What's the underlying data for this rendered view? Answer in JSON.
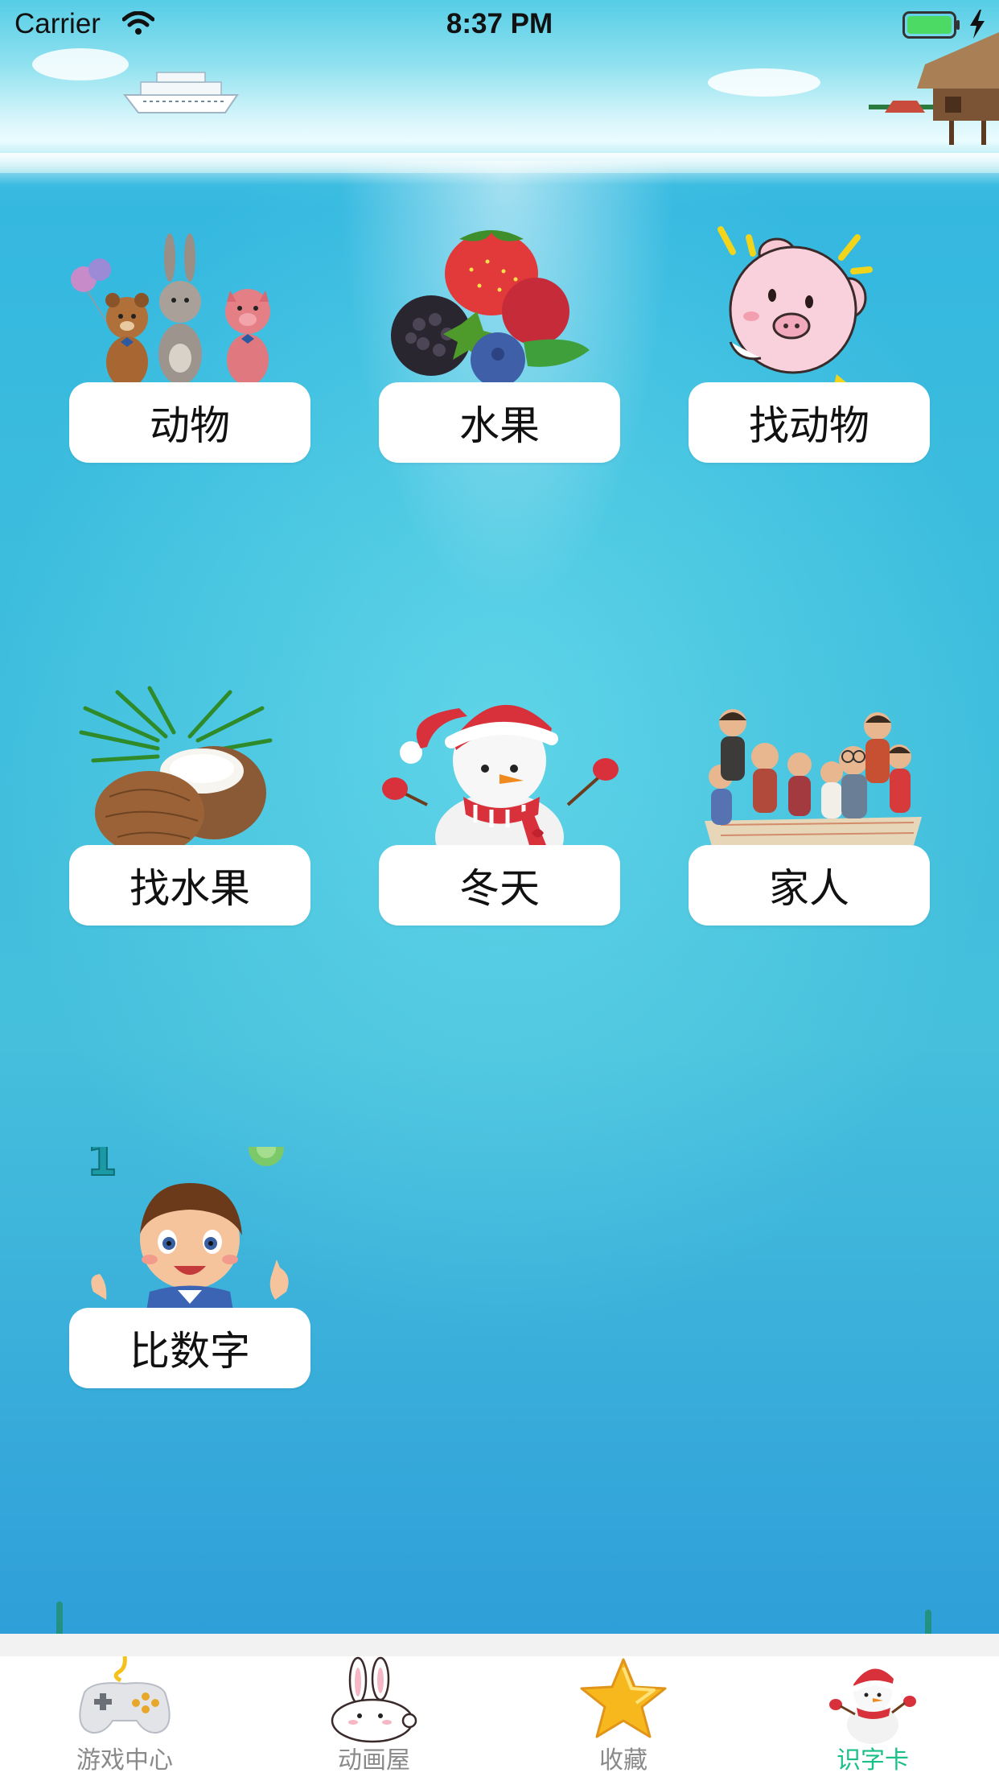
{
  "status_bar": {
    "carrier": "Carrier",
    "time": "8:37 PM",
    "battery_color": "#4cd964"
  },
  "categories": [
    {
      "label": "动物",
      "icon": "animals-icon"
    },
    {
      "label": "水果",
      "icon": "fruits-icon"
    },
    {
      "label": "找动物",
      "icon": "pig-icon"
    },
    {
      "label": "找水果",
      "icon": "coconut-icon"
    },
    {
      "label": "冬天",
      "icon": "snowman-icon"
    },
    {
      "label": "家人",
      "icon": "family-icon"
    },
    {
      "label": "比数字",
      "icon": "boy-number-icon",
      "art_number": "1"
    }
  ],
  "tab_bar": {
    "active_color": "#1bbf8a",
    "inactive_color": "#8a8a8a",
    "tabs": [
      {
        "label": "游戏中心",
        "icon": "gamepad-icon",
        "active": false
      },
      {
        "label": "动画屋",
        "icon": "bunny-icon",
        "active": false
      },
      {
        "label": "收藏",
        "icon": "star-icon",
        "active": false
      },
      {
        "label": "识字卡",
        "icon": "snowman-icon",
        "active": true
      }
    ]
  }
}
